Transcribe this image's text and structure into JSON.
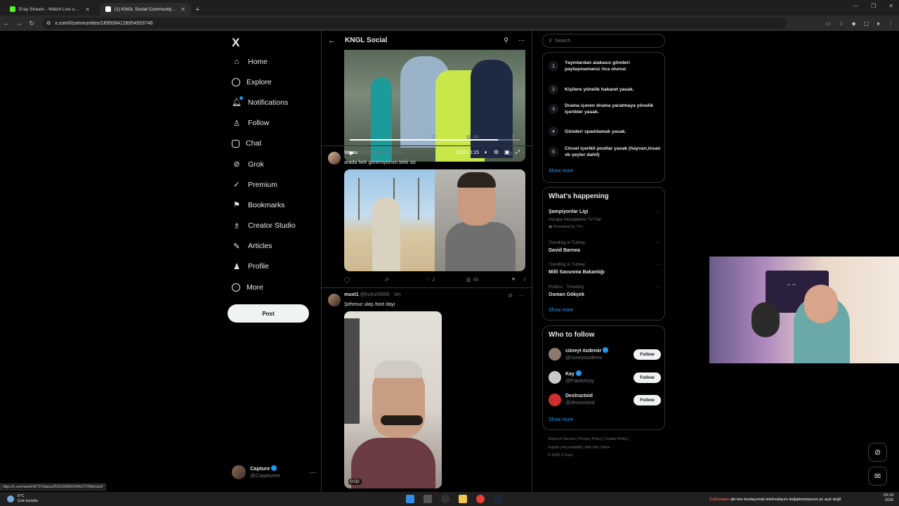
{
  "browser": {
    "tabs": [
      {
        "label": "Eray Stream - Watch Live on Ki",
        "favicon_color": "#53fc18"
      },
      {
        "label": "(1) KNGL Social Community / X",
        "favicon_color": "#ffffff"
      }
    ],
    "url": "x.com/i/communities/1895084128954933746"
  },
  "nav": {
    "logo": "X",
    "items": [
      {
        "label": "Home",
        "icon": "home-icon"
      },
      {
        "label": "Explore",
        "icon": "search-icon"
      },
      {
        "label": "Notifications",
        "icon": "bell-icon"
      },
      {
        "label": "Follow",
        "icon": "person-plus-icon"
      },
      {
        "label": "Chat",
        "icon": "mail-icon"
      },
      {
        "label": "Grok",
        "icon": "grok-icon"
      },
      {
        "label": "Premium",
        "icon": "premium-icon"
      },
      {
        "label": "Bookmarks",
        "icon": "bookmark-icon"
      },
      {
        "label": "Creator Studio",
        "icon": "creator-icon"
      },
      {
        "label": "Articles",
        "icon": "article-icon"
      },
      {
        "label": "Profile",
        "icon": "person-icon"
      },
      {
        "label": "More",
        "icon": "more-circle-icon"
      }
    ],
    "post_label": "Post",
    "account": {
      "name": "Capture",
      "handle": "@Cappturee"
    }
  },
  "header": {
    "title": "KNGL Social"
  },
  "feed": {
    "video1": {
      "time": "0:13 / 0:15",
      "progress": 0.87,
      "replies": "",
      "reposts": "",
      "likes": "2",
      "views": "40"
    },
    "tweet2": {
      "name": "Varsu",
      "handle": "@saruh42737",
      "time": "2m",
      "text": "arada fark göremiyorum beki siz",
      "likes": "2",
      "views": "40"
    },
    "tweet3": {
      "name": "must1",
      "handle": "@huhu09856",
      "time": "3m",
      "text": "Şehmuz ulaş /tost dayı",
      "video_time": "0:02"
    }
  },
  "sidebar": {
    "search_placeholder": "Search",
    "rules": [
      {
        "num": "1",
        "text": "Yayınlardan alakasız gönderi paylaşmamanız rica olunur."
      },
      {
        "num": "2",
        "text": "Kişilere yönelik hakaret yasak."
      },
      {
        "num": "3",
        "text": "Drama içeren drama yaratmaya yönelik içerikler yasak."
      },
      {
        "num": "4",
        "text": "Gönderi spamlamak yasak."
      },
      {
        "num": "5",
        "text": "Cinsel içerikli postlar yasak (hayvan,insan vb şeyler dahil)"
      }
    ],
    "show_more": "Show more",
    "happening_title": "What's happening",
    "trends": [
      {
        "title": "Şampiyonlar Ligi",
        "sub": "Avrupa mücadelesi TV+'ta!",
        "meta": "Promoted by TV+"
      },
      {
        "context": "Trending in Turkey",
        "title": "David Barnea"
      },
      {
        "context": "Trending in Turkey",
        "title": "Milli Savunma Bakanlığı"
      },
      {
        "context": "Politics · Trending",
        "title": "Osman Gökçek"
      }
    ],
    "wtf_title": "Who to follow",
    "follow_label": "Follow",
    "suggestions": [
      {
        "name": "cüneyt özdemir",
        "handle": "@cuneytozdemir",
        "color": "#8c7a6e"
      },
      {
        "name": "Kay",
        "handle": "@FrazierKay",
        "color": "#c9c9c9"
      },
      {
        "name": "Destructoid",
        "handle": "@destructoid",
        "color": "#d12f2f"
      }
    ],
    "footer": {
      "line1": "Terms of Service  |  Privacy Policy  |  Cookie Policy  |",
      "line2": "Imprint  |  Accessibility  |  Ads info  |  More ···",
      "line3": "© 2026 X Corp."
    }
  },
  "status_url": "https://x.com/saruh42737/status/2031160602534527278/photo/2",
  "taskbar": {
    "temp": "6°C",
    "weather": "Çok bulutlu",
    "time": "03:19",
    "date": "2026",
    "chat_user": "CsScream",
    "chat_msg": ": abi ben burdayımda telefondayım değiştiremiyorum pc açık değil"
  }
}
